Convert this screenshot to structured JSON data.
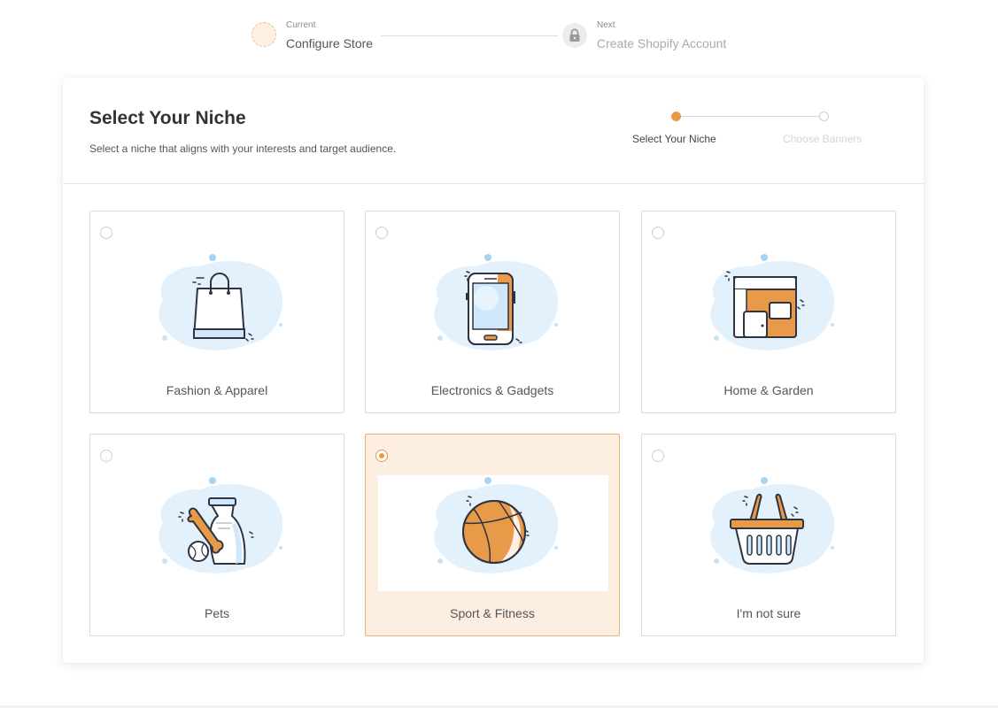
{
  "top_steps": {
    "current_caption": "Current",
    "current_label": "Configure Store",
    "next_caption": "Next",
    "next_label": "Create Shopify Account"
  },
  "header": {
    "title": "Select Your Niche",
    "subtitle": "Select a niche that aligns with your interests and target audience."
  },
  "sub_steps": [
    "Select Your Niche",
    "Choose Banners"
  ],
  "niches": [
    {
      "label": "Fashion & Apparel",
      "icon": "shopping-bag-icon",
      "selected": false
    },
    {
      "label": "Electronics & Gadgets",
      "icon": "smartphone-icon",
      "selected": false
    },
    {
      "label": "Home & Garden",
      "icon": "house-icon",
      "selected": false
    },
    {
      "label": "Pets",
      "icon": "pet-food-bag-icon",
      "selected": false
    },
    {
      "label": "Sport & Fitness",
      "icon": "basketball-icon",
      "selected": true
    },
    {
      "label": "I'm not sure",
      "icon": "basket-icon",
      "selected": false
    }
  ],
  "colors": {
    "accent": "#e99a48",
    "selected_bg": "#fcefe2",
    "illustration_blue": "#d6ebfa"
  }
}
